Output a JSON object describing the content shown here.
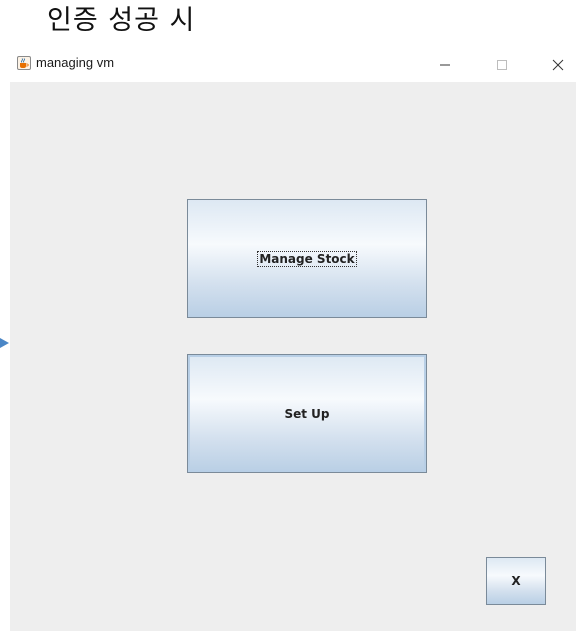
{
  "heading": "인증 성공 시",
  "window": {
    "title": "managing vm",
    "icon": "java-cup-icon",
    "controls": {
      "minimize_icon": "minimize-icon",
      "maximize_icon": "maximize-icon",
      "close_icon": "close-icon"
    }
  },
  "buttons": {
    "manage_stock": "Manage Stock",
    "set_up": "Set Up",
    "exit": "X"
  },
  "colors": {
    "content_background": "#eeeeee",
    "button_border": "#7a8a99",
    "button_gradient_light": "#f7fafd",
    "button_gradient_dark": "#b9cfe5",
    "side_arrow": "#4a86c6"
  }
}
